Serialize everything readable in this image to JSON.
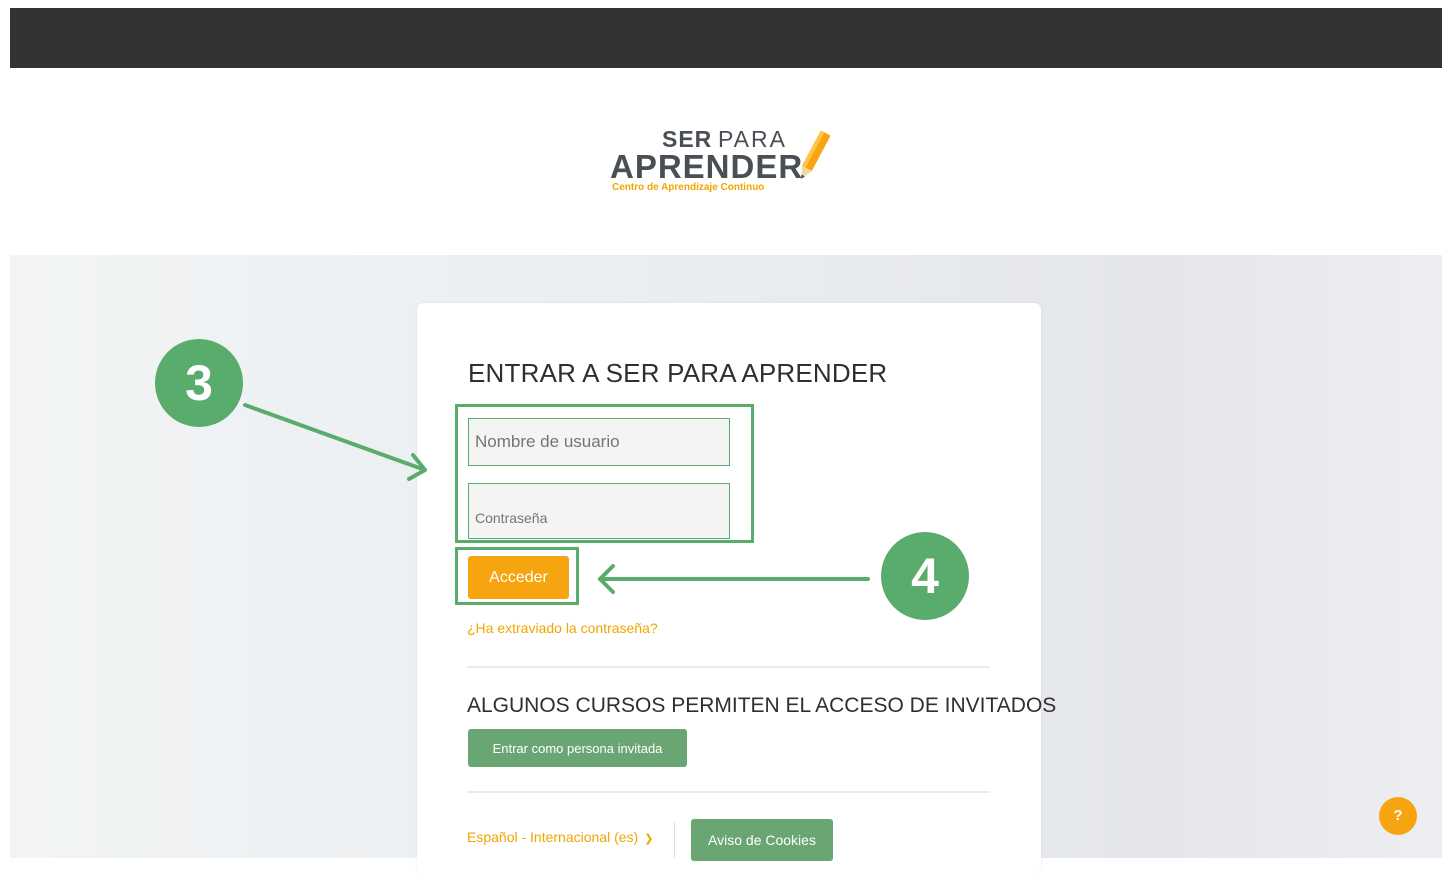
{
  "logo": {
    "ser": "SER",
    "para": "PARA",
    "aprender": "APRENDER",
    "tagline": "Centro de Aprendizaje Continuo",
    "icon": "pencil-icon"
  },
  "login": {
    "heading": "ENTRAR A SER PARA APRENDER",
    "username_placeholder": "Nombre de usuario",
    "password_placeholder": "Contraseña",
    "submit_label": "Acceder",
    "forgot_link": "¿Ha extraviado la contraseña?"
  },
  "guest": {
    "heading": "ALGUNOS CURSOS PERMITEN EL ACCESO DE INVITADOS",
    "button_label": "Entrar como persona invitada"
  },
  "footer": {
    "language": "Español - Internacional (es)",
    "language_icon": "chevron-down-icon",
    "cookies_label": "Aviso de Cookies"
  },
  "help": {
    "label": "?",
    "icon": "question-icon"
  },
  "annotations": {
    "step_3": "3",
    "step_4": "4"
  },
  "colors": {
    "topbar": "#333333",
    "accent_orange": "#f6a40f",
    "green": "#6aa674",
    "annotation_green": "#5aac6c",
    "text_dark": "#2f2f2f",
    "logo_gray": "#4a4f55"
  }
}
